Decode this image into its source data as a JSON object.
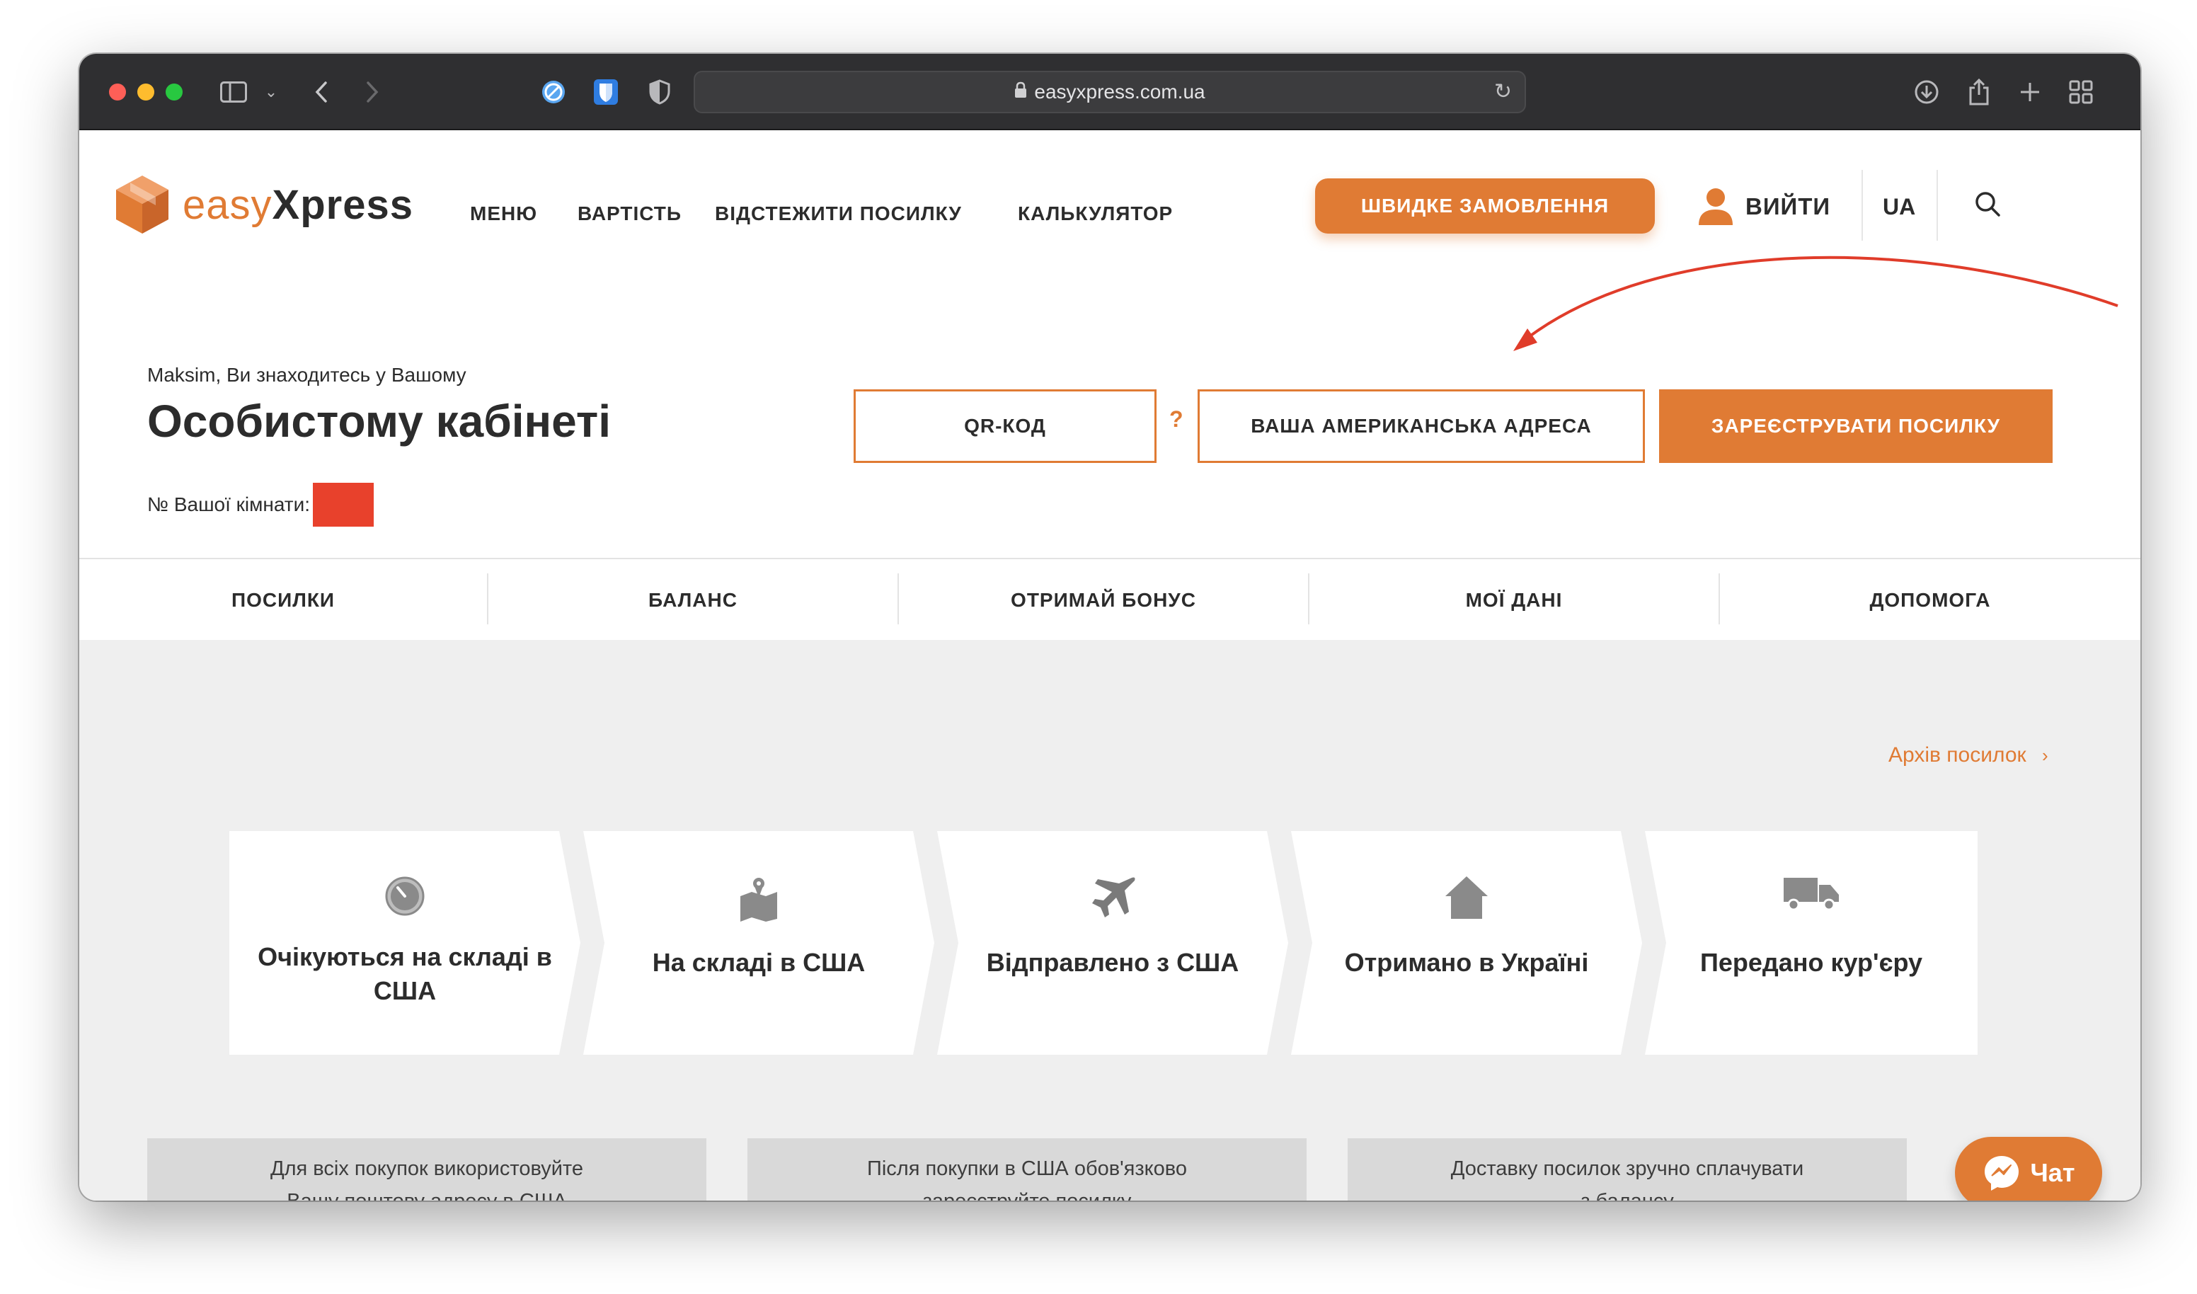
{
  "browser": {
    "url": "easyxpress.com.ua"
  },
  "header": {
    "logo_easy": "easy",
    "logo_xpress": "Xpress",
    "nav": [
      "МЕНЮ",
      "ВАРТІСТЬ",
      "ВІДСТЕЖИТИ ПОСИЛКУ",
      "КАЛЬКУЛЯТОР"
    ],
    "quick_order": "ШВИДКЕ ЗАМОВЛЕННЯ",
    "logout": "ВИЙТИ",
    "lang": "UA"
  },
  "greeting": {
    "small": "Maksim, Ви знаходитесь у Вашому",
    "big": "Особистому кабінеті",
    "room_label": "№ Вашої кімнати:"
  },
  "actions": {
    "qr": "QR-КОД",
    "help_mark": "?",
    "address": "ВАША АМЕРИКАНСЬКА АДРЕСА",
    "register": "ЗАРЕЄСТРУВАТИ ПОСИЛКУ"
  },
  "tabs": [
    "ПОСИЛКИ",
    "БАЛАНС",
    "ОТРИМАЙ БОНУС",
    "МОЇ ДАНІ",
    "ДОПОМОГА"
  ],
  "archive_link": "Архів посилок",
  "statuses": [
    {
      "label": "Очікуються на складі в США",
      "icon": "clock-icon"
    },
    {
      "label": "На складі в США",
      "icon": "map-pin-icon"
    },
    {
      "label": "Відправлено з США",
      "icon": "airplane-icon"
    },
    {
      "label": "Отримано в Україні",
      "icon": "house-icon"
    },
    {
      "label": "Передано кур'єру",
      "icon": "truck-icon"
    }
  ],
  "info_cards": [
    {
      "line1": "Для всіх покупок використовуйте",
      "line2": "Вашу поштову адресу в США"
    },
    {
      "line1": "Після покупки в США обов'язково",
      "line2": "зареєструйте посилку"
    },
    {
      "line1": "Доставку посилок зручно сплачувати",
      "line2": "з балансу"
    }
  ],
  "chat": "Чат",
  "colors": {
    "accent": "#e07b34",
    "room_redaction": "#e8412c",
    "annotation_arrow": "#e03c2a"
  }
}
